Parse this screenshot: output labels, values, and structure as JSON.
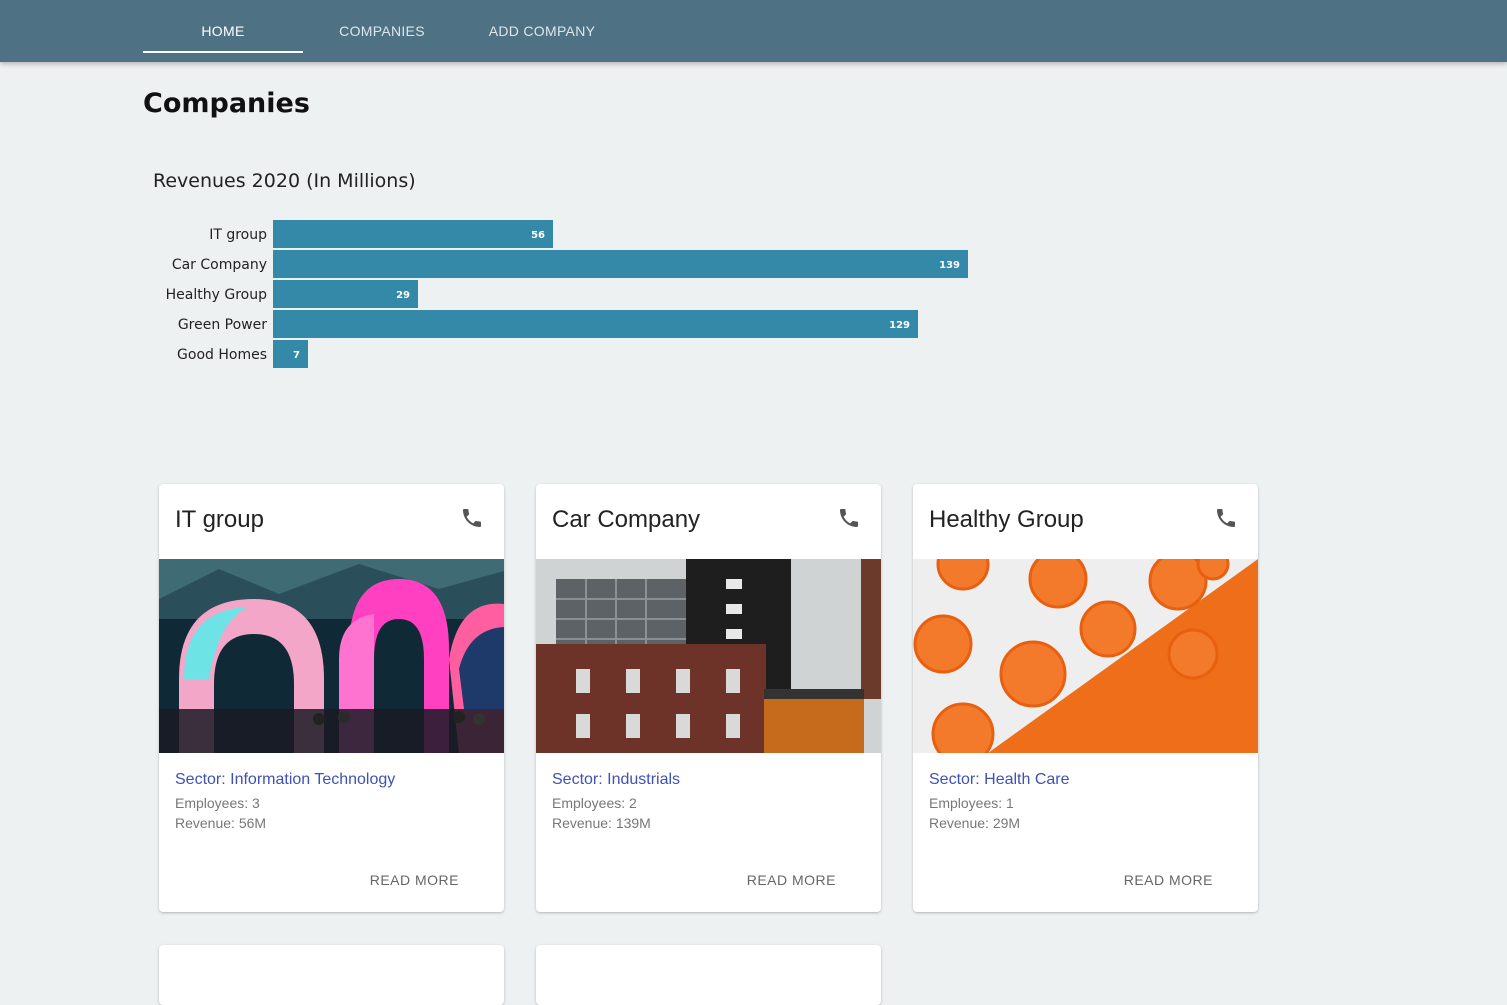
{
  "nav": {
    "tabs": [
      {
        "label": "HOME",
        "active": true
      },
      {
        "label": "COMPANIES",
        "active": false
      },
      {
        "label": "ADD COMPANY",
        "active": false
      }
    ]
  },
  "page": {
    "title": "Companies"
  },
  "chart_data": {
    "type": "bar",
    "orientation": "horizontal",
    "title": "Revenues 2020 (In Millions)",
    "categories": [
      "IT group",
      "Car Company",
      "Healthy Group",
      "Green Power",
      "Good Homes"
    ],
    "values": [
      56,
      139,
      29,
      129,
      7
    ],
    "data_labels": [
      "56",
      "139",
      "29",
      "129",
      "7"
    ],
    "xlabel": "",
    "ylabel": "",
    "xlim": [
      0,
      139
    ],
    "grid": false,
    "color": "#3589a8"
  },
  "cards": [
    {
      "title": "IT group",
      "sector": "Sector: Information Technology",
      "employees": "Employees: 3",
      "revenue": "Revenue: 56M",
      "action": "READ MORE",
      "image": "inflatable-arches-photo"
    },
    {
      "title": "Car Company",
      "sector": "Sector: Industrials",
      "employees": "Employees: 2",
      "revenue": "Revenue: 139M",
      "action": "READ MORE",
      "image": "office-buildings-photo"
    },
    {
      "title": "Healthy Group",
      "sector": "Sector: Health Care",
      "employees": "Employees: 1",
      "revenue": "Revenue: 29M",
      "action": "READ MORE",
      "image": "carrot-slices-photo"
    }
  ],
  "icons": {
    "card_action": "phone-icon"
  },
  "colors": {
    "nav_bg": "#4e7184",
    "accent": "#3f51b5",
    "bar": "#3589a8"
  }
}
